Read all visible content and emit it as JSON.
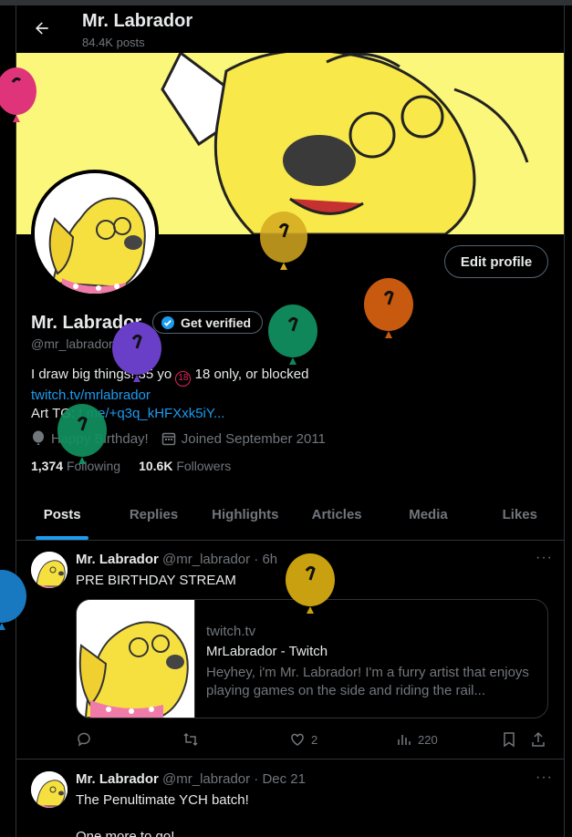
{
  "header": {
    "name": "Mr. Labrador",
    "posts": "84.4K posts"
  },
  "profile": {
    "name": "Mr. Labrador",
    "get_verified": "Get verified",
    "handle": "@mr_labrador",
    "edit_profile": "Edit profile",
    "bio_line1": "I draw big things! 35 yo",
    "bio_badge": "18",
    "bio_line1_end": "18 only, or blocked",
    "bio_link1": "twitch.tv/mrlabrador",
    "bio_line3_prefix": "Art TG: ",
    "bio_link2": "t.me/+q3q_kHFXxk5iY...",
    "birthday": "Happy Birthday!",
    "joined": "Joined September 2011",
    "following_count": "1,374",
    "following_label": "Following",
    "followers_count": "10.6K",
    "followers_label": "Followers"
  },
  "tabs": [
    {
      "label": "Posts",
      "active": true
    },
    {
      "label": "Replies"
    },
    {
      "label": "Highlights"
    },
    {
      "label": "Articles"
    },
    {
      "label": "Media"
    },
    {
      "label": "Likes"
    }
  ],
  "tweets": [
    {
      "name": "Mr. Labrador",
      "handle_time": "@mr_labrador · 6h",
      "text": "PRE BIRTHDAY STREAM",
      "card": {
        "domain": "twitch.tv",
        "title": "MrLabrador - Twitch",
        "description": "Heyhey, i'm Mr. Labrador! I'm a furry artist that enjoys playing games on the side and riding the rail..."
      },
      "likes": "2",
      "views": "220"
    },
    {
      "name": "Mr. Labrador",
      "handle_time": "@mr_labrador · Dec 21",
      "text": "The Penultimate YCH batch!",
      "text2": "One more to go!"
    }
  ],
  "colors": {
    "accent": "#1d9bf0",
    "banner": "#fbf77a",
    "balloons": [
      "#e0347a",
      "#d4a820",
      "#c85a10",
      "#10875a",
      "#6a3fc8",
      "#109060",
      "#c8a010",
      "#1878c0"
    ]
  },
  "icons": [
    "back-arrow-icon",
    "verified-badge-icon",
    "balloon-icon",
    "calendar-icon",
    "more-icon",
    "reply-icon",
    "repost-icon",
    "like-icon",
    "views-icon",
    "bookmark-icon",
    "share-icon"
  ]
}
